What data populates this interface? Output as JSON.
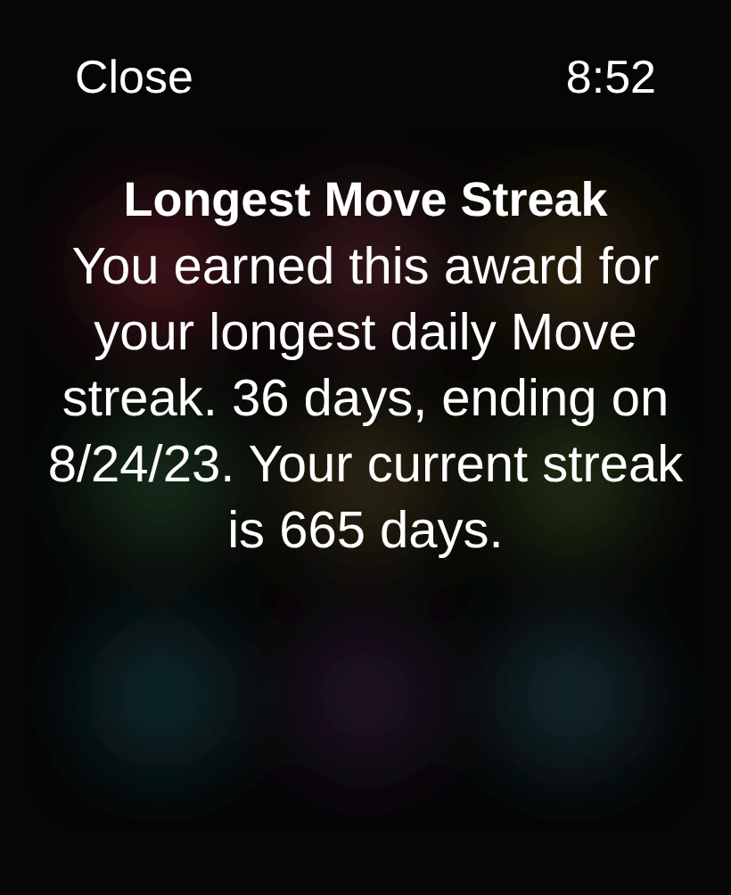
{
  "status_bar": {
    "close": "Close",
    "time": "8:52"
  },
  "award": {
    "title": "Longest Move Streak",
    "description": "You earned this award for your longest daily Move streak. 36 days, ending on 8/24/23. Your current streak is 665 days."
  }
}
